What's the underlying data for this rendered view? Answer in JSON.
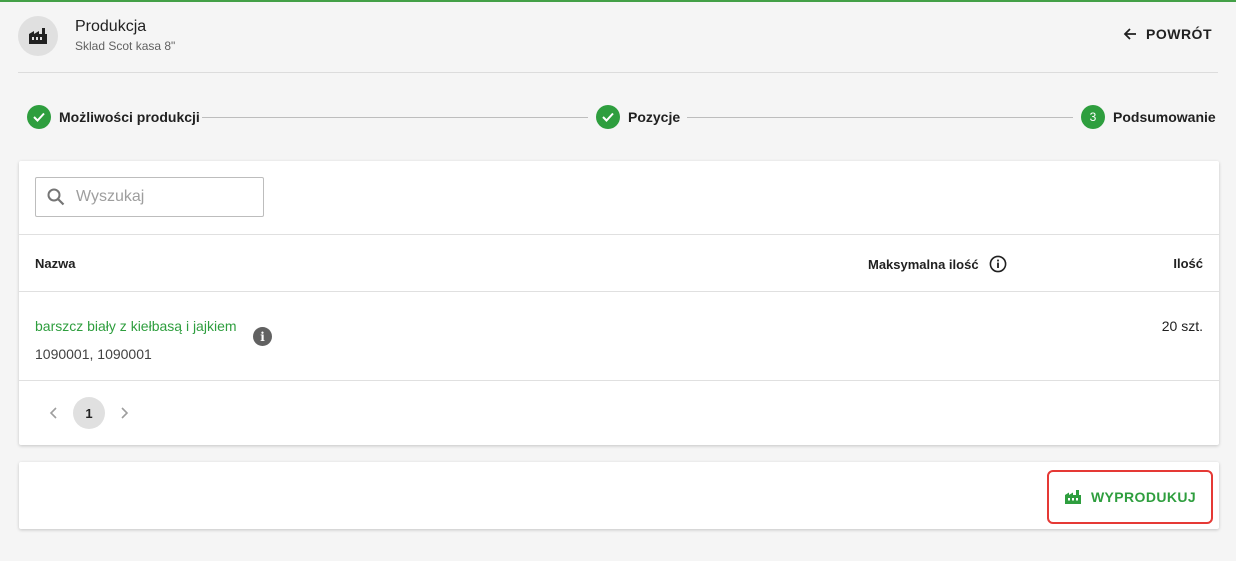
{
  "header": {
    "title": "Produkcja",
    "subtitle": "Sklad Scot kasa 8\"",
    "back_label": "POWRÓT",
    "icon": "factory-icon"
  },
  "stepper": {
    "steps": [
      {
        "label": "Możliwości produkcji",
        "state": "completed"
      },
      {
        "label": "Pozycje",
        "state": "completed"
      },
      {
        "number": "3",
        "label": "Podsumowanie",
        "state": "active"
      }
    ]
  },
  "search": {
    "placeholder": "Wyszukaj",
    "value": ""
  },
  "table": {
    "columns": {
      "name": "Nazwa",
      "max_qty": "Maksymalna ilość",
      "qty": "Ilość"
    },
    "rows": [
      {
        "name": "barszcz biały z kiełbasą i jajkiem",
        "codes": "1090001, 1090001",
        "qty": "20 szt."
      }
    ]
  },
  "pagination": {
    "current_page": "1"
  },
  "actions": {
    "produce_label": "WYPRODUKUJ"
  },
  "colors": {
    "accent": "#2e9e3e",
    "highlight_border": "#e53935",
    "top_bar": "#43a047"
  }
}
